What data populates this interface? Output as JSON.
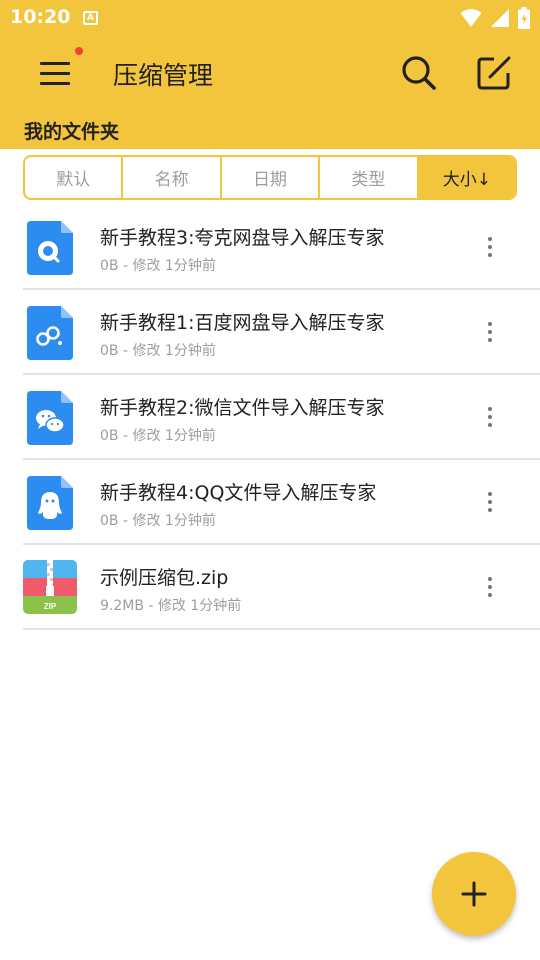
{
  "status_bar": {
    "time": "10:20",
    "notification_icon": "A"
  },
  "header": {
    "menu_icon": "hamburger-menu-icon",
    "has_notification_dot": true,
    "title": "压缩管理",
    "search_icon": "search-icon",
    "edit_icon": "edit-square-icon"
  },
  "folder_label": "我的文件夹",
  "sort_tabs": [
    {
      "label": "默认",
      "active": false
    },
    {
      "label": "名称",
      "active": false
    },
    {
      "label": "日期",
      "active": false
    },
    {
      "label": "类型",
      "active": false
    },
    {
      "label": "大小↓",
      "active": true
    }
  ],
  "files": [
    {
      "name": "新手教程3:夸克网盘导入解压专家",
      "meta": "0B - 修改 1分钟前",
      "icon": "quark-doc-icon"
    },
    {
      "name": "新手教程1:百度网盘导入解压专家",
      "meta": "0B - 修改 1分钟前",
      "icon": "baidu-doc-icon"
    },
    {
      "name": "新手教程2:微信文件导入解压专家",
      "meta": "0B - 修改 1分钟前",
      "icon": "wechat-doc-icon"
    },
    {
      "name": "新手教程4:QQ文件导入解压专家",
      "meta": "0B - 修改 1分钟前",
      "icon": "qq-doc-icon"
    },
    {
      "name": "示例压缩包.zip",
      "meta": "9.2MB - 修改 1分钟前",
      "icon": "zip-archive-icon"
    }
  ],
  "fab": {
    "icon": "plus-icon"
  },
  "colors": {
    "accent": "#F2C53D",
    "doc_blue": "#2D8CF0",
    "divider": "#e3e3e3"
  }
}
